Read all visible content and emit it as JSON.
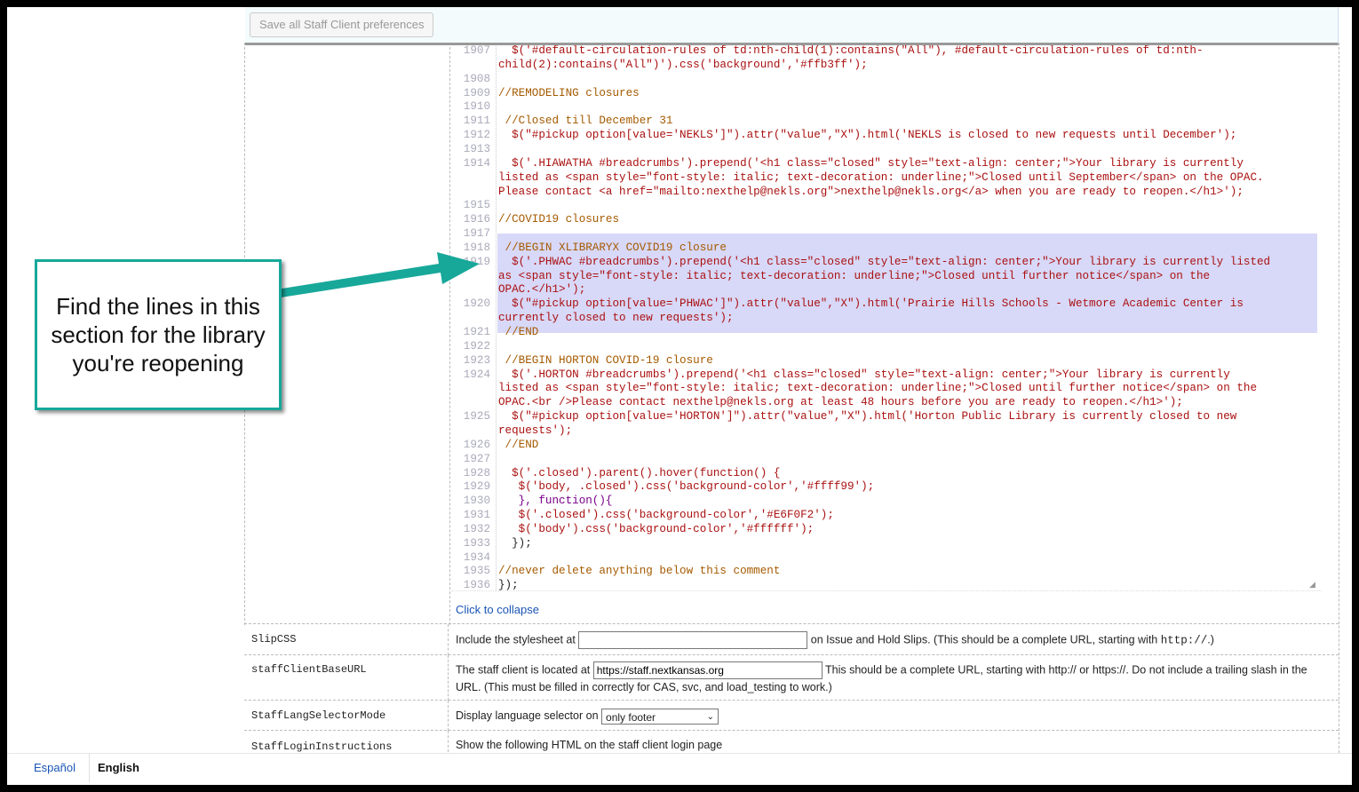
{
  "toolbar": {
    "save_label": "Save all Staff Client preferences"
  },
  "code_lines": [
    {
      "n": "1907",
      "t": "  $('#default-circulation-rules of td:nth-child(1):contains(\"All\"), #default-circulation-rules of td:nth-",
      "c": "c-code"
    },
    {
      "n": "",
      "t": "child(2):contains(\"All\")').css('background','#ffb3ff');",
      "c": "c-code"
    },
    {
      "n": "1908",
      "t": "",
      "c": "c-plain"
    },
    {
      "n": "1909",
      "t": "//REMODELING closures",
      "c": "c-comment"
    },
    {
      "n": "1910",
      "t": "",
      "c": "c-plain"
    },
    {
      "n": "1911",
      "t": " //Closed till December 31",
      "c": "c-comment"
    },
    {
      "n": "1912",
      "t": "  $(\"#pickup option[value='NEKLS']\").attr(\"value\",\"X\").html('NEKLS is closed to new requests until December');",
      "c": "c-code"
    },
    {
      "n": "1913",
      "t": "",
      "c": "c-plain"
    },
    {
      "n": "1914",
      "t": "  $('.HIAWATHA #breadcrumbs').prepend('<h1 class=\"closed\" style=\"text-align: center;\">Your library is currently",
      "c": "c-code"
    },
    {
      "n": "",
      "t": "listed as <span style=\"font-style: italic; text-decoration: underline;\">Closed until September</span> on the OPAC.",
      "c": "c-code"
    },
    {
      "n": "",
      "t": "Please contact <a href=\"mailto:nexthelp@nekls.org\">nexthelp@nekls.org</a> when you are ready to reopen.</h1>');",
      "c": "c-code"
    },
    {
      "n": "1915",
      "t": "",
      "c": "c-plain"
    },
    {
      "n": "1916",
      "t": "//COVID19 closures",
      "c": "c-comment"
    },
    {
      "n": "1917",
      "t": "",
      "c": "c-plain"
    },
    {
      "n": "1918",
      "t": " //BEGIN XLIBRARYX COVID19 closure",
      "c": "c-comment"
    },
    {
      "n": "1919",
      "t": "  $('.PHWAC #breadcrumbs').prepend('<h1 class=\"closed\" style=\"text-align: center;\">Your library is currently listed",
      "c": "c-code"
    },
    {
      "n": "",
      "t": "as <span style=\"font-style: italic; text-decoration: underline;\">Closed until further notice</span> on the",
      "c": "c-code"
    },
    {
      "n": "",
      "t": "OPAC.</h1>');",
      "c": "c-code"
    },
    {
      "n": "1920",
      "t": "  $(\"#pickup option[value='PHWAC']\").attr(\"value\",\"X\").html('Prairie Hills Schools - Wetmore Academic Center is",
      "c": "c-code"
    },
    {
      "n": "",
      "t": "currently closed to new requests');",
      "c": "c-code"
    },
    {
      "n": "1921",
      "t": " //END",
      "c": "c-comment"
    },
    {
      "n": "1922",
      "t": "",
      "c": "c-plain"
    },
    {
      "n": "1923",
      "t": " //BEGIN HORTON COVID-19 closure",
      "c": "c-comment"
    },
    {
      "n": "1924",
      "t": "  $('.HORTON #breadcrumbs').prepend('<h1 class=\"closed\" style=\"text-align: center;\">Your library is currently",
      "c": "c-code"
    },
    {
      "n": "",
      "t": "listed as <span style=\"font-style: italic; text-decoration: underline;\">Closed until further notice</span> on the",
      "c": "c-code"
    },
    {
      "n": "",
      "t": "OPAC.<br />Please contact nexthelp@nekls.org at least 48 hours before you are ready to reopen.</h1>');",
      "c": "c-code"
    },
    {
      "n": "1925",
      "t": "  $(\"#pickup option[value='HORTON']\").attr(\"value\",\"X\").html('Horton Public Library is currently closed to new",
      "c": "c-code"
    },
    {
      "n": "",
      "t": "requests');",
      "c": "c-code"
    },
    {
      "n": "1926",
      "t": " //END",
      "c": "c-comment"
    },
    {
      "n": "1927",
      "t": "",
      "c": "c-plain"
    },
    {
      "n": "1928",
      "t": "  $('.closed').parent().hover(function() {",
      "c": "c-code"
    },
    {
      "n": "1929",
      "t": "   $('body, .closed').css('background-color','#ffff99');",
      "c": "c-code"
    },
    {
      "n": "1930",
      "t": "   }, function(){",
      "c": "c-kw"
    },
    {
      "n": "1931",
      "t": "   $('.closed').css('background-color','#E6F0F2');",
      "c": "c-code"
    },
    {
      "n": "1932",
      "t": "   $('body').css('background-color','#ffffff');",
      "c": "c-code"
    },
    {
      "n": "1933",
      "t": "  });",
      "c": "c-plain"
    },
    {
      "n": "1934",
      "t": "",
      "c": "c-plain"
    },
    {
      "n": "1935",
      "t": "//never delete anything below this comment",
      "c": "c-comment"
    },
    {
      "n": "1936",
      "t": "});",
      "c": "c-plain"
    }
  ],
  "collapse_label": "Click to collapse",
  "prefs": {
    "slipcss": {
      "key": "SlipCSS",
      "before": "Include the stylesheet at",
      "value": "",
      "after": "on Issue and Hold Slips. (This should be a complete URL, starting with ",
      "code": "http://",
      "end": ".)"
    },
    "baseurl": {
      "key": "staffClientBaseURL",
      "before": "The staff client is located at",
      "value": "https://staff.nextkansas.org",
      "after": "This should be a complete URL, starting with http:// or https://. Do not include a trailing slash in the URL. (This must be filled in correctly for CAS, svc, and load_testing to work.)"
    },
    "langmode": {
      "key": "StaffLangSelectorMode",
      "before": "Display language selector on",
      "selected": "only footer"
    },
    "login": {
      "key": "StaffLoginInstructions",
      "before": "Show the following HTML on the staff client login page"
    }
  },
  "footer": {
    "lang_es": "Español",
    "lang_en": "English"
  },
  "callout": {
    "text": "Find the lines in this section for the library you're reopening",
    "color": "#17a89a"
  },
  "colors": {
    "highlight": "#d8d8f8",
    "accent": "#17a89a",
    "link": "#1a55b5"
  }
}
